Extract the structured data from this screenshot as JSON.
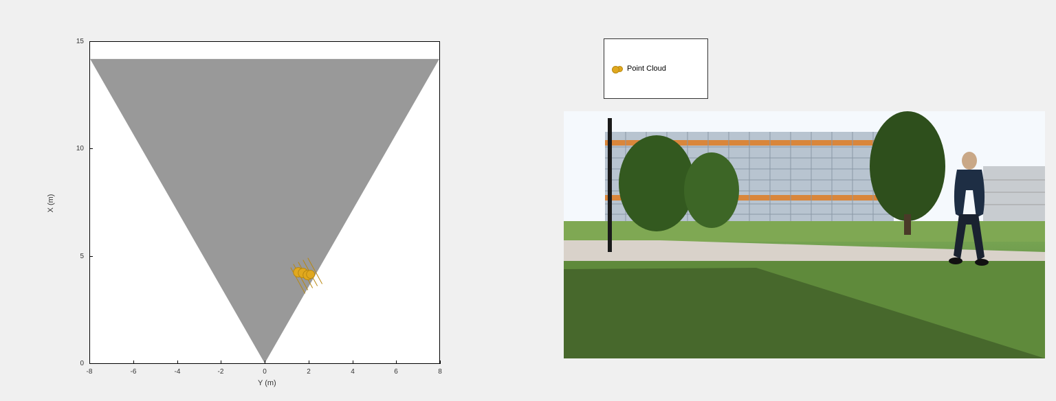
{
  "chart_data": {
    "type": "scatter",
    "title": "",
    "xlabel": "Y (m)",
    "ylabel": "X (m)",
    "xlim": [
      -8,
      8
    ],
    "ylim": [
      0,
      15
    ],
    "x_ticks": [
      -8,
      -6,
      -4,
      -2,
      0,
      2,
      4,
      6,
      8
    ],
    "y_ticks": [
      0,
      5,
      10,
      15
    ],
    "fov_triangle": [
      [
        0,
        0
      ],
      [
        -8,
        14.2
      ],
      [
        8,
        14.2
      ]
    ],
    "series": [
      {
        "name": "Point Cloud",
        "color": "#e0a81e",
        "points": [
          {
            "y": 1.55,
            "x": 4.25
          },
          {
            "y": 1.75,
            "x": 4.2
          },
          {
            "y": 1.95,
            "x": 4.1
          },
          {
            "y": 2.1,
            "x": 4.15
          }
        ]
      }
    ]
  },
  "legend": {
    "label": "Point Cloud"
  },
  "axes": {
    "xlabel": "Y (m)",
    "ylabel": "X (m)"
  }
}
